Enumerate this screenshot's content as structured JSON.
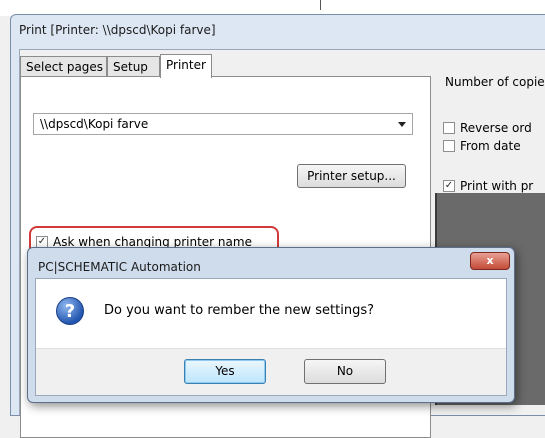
{
  "window": {
    "title": "Print [Printer: \\\\dpscd\\Kopi farve]"
  },
  "tabs": [
    {
      "label": "Select pages",
      "active": false
    },
    {
      "label": "Setup",
      "active": false
    },
    {
      "label": "Printer",
      "active": true
    }
  ],
  "printer": {
    "selected": "\\\\dpscd\\Kopi farve",
    "setup_button": "Printer setup...",
    "ask_checkbox": {
      "label": "Ask when changing printer name",
      "checked": true
    }
  },
  "right_panel": {
    "copies_label": "Number of copie",
    "reverse_label": "Reverse ord",
    "reverse_checked": false,
    "from_date_label": "From date",
    "from_date_checked": false,
    "print_with_label": "Print with pr",
    "print_with_checked": true
  },
  "dialog": {
    "title": "PC|SCHEMATIC Automation",
    "close_glyph": "x",
    "icon": "question-icon",
    "message": "Do you want to rember the new settings?",
    "yes_label": "Yes",
    "no_label": "No"
  },
  "colors": {
    "highlight_border": "#d23a3a",
    "default_button": "#bee6fd",
    "close_button": "#c44a38"
  }
}
